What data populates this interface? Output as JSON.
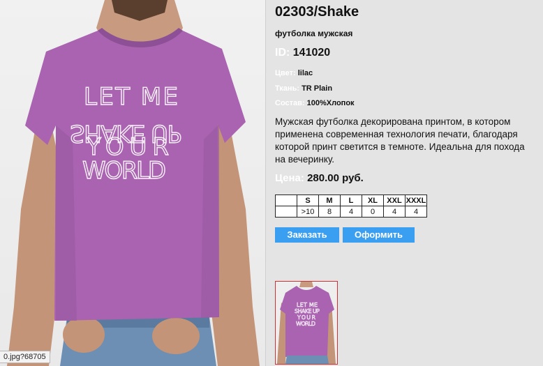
{
  "product": {
    "title": "02303/Shake",
    "subtitle": "футболка мужская",
    "id_label": "ID:",
    "id_value": "141020",
    "attributes": [
      {
        "label": "Цвет:",
        "value": "lilac"
      },
      {
        "label": "Ткань:",
        "value": "TR Plain"
      },
      {
        "label": "Состав:",
        "value": "100%Хлопок"
      }
    ],
    "description": "Мужская футболка декорирована принтом, в котором применена современная технология печати, благодаря которой принт светится в темноте. Идеальна для похода на вечеринку.",
    "price_label": "Цена:",
    "price_value": "280.00 руб."
  },
  "sizes": {
    "headers": [
      "",
      "S",
      "M",
      "L",
      "XL",
      "XXL",
      "XXXL"
    ],
    "stock": [
      "",
      ">10",
      "8",
      "4",
      "0",
      "4",
      "4"
    ]
  },
  "buttons": {
    "order": "Заказать",
    "checkout": "Оформить"
  },
  "image": {
    "print_text": [
      "LET ME",
      "SHAKE UP",
      "YOUR",
      "WORLD"
    ],
    "shirt_color": "#a963b0"
  },
  "status": {
    "url_fragment": "0.jpg?68705"
  }
}
